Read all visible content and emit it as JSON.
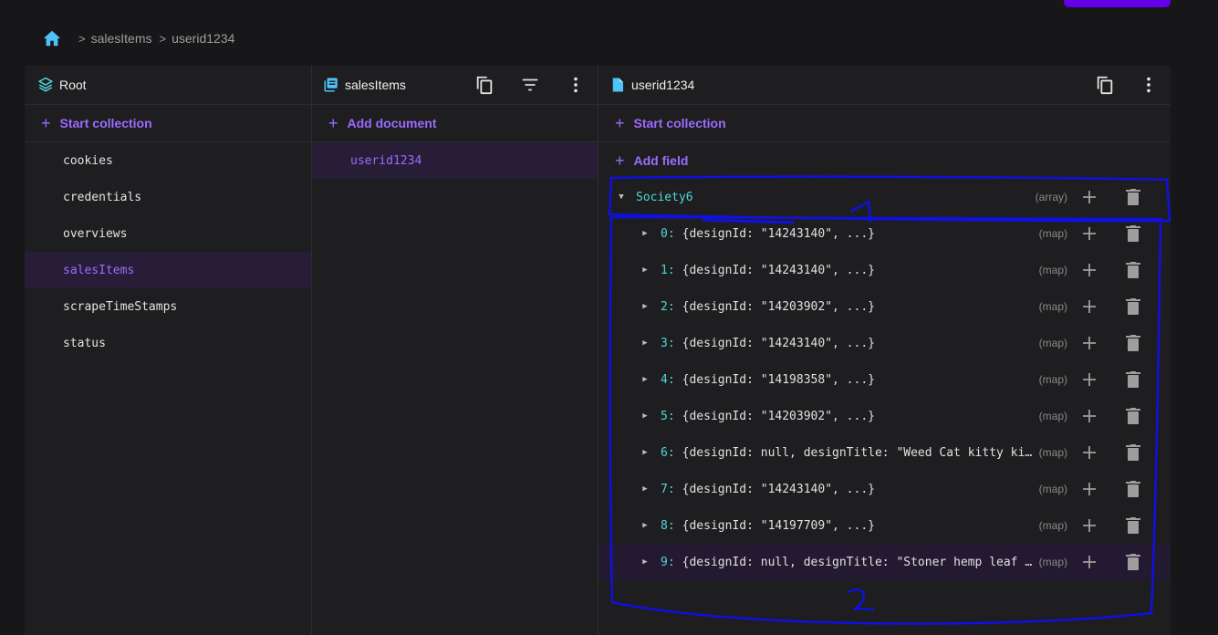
{
  "breadcrumb": {
    "home_icon": "home-icon",
    "items": [
      "salesItems",
      "userid1234"
    ]
  },
  "root_panel": {
    "title": "Root",
    "start_collection": "Start collection",
    "collections": [
      "cookies",
      "credentials",
      "overviews",
      "salesItems",
      "scrapeTimeStamps",
      "status"
    ],
    "selected": "salesItems"
  },
  "collection_panel": {
    "title": "salesItems",
    "add_document": "Add document",
    "documents": [
      "userid1234"
    ],
    "selected": "userid1234"
  },
  "document_panel": {
    "title": "userid1234",
    "start_collection": "Start collection",
    "add_field": "Add field",
    "field": {
      "key": "Society6",
      "type": "(array)"
    },
    "entries": [
      {
        "index": "0:",
        "value": "{designId: \"14243140\", ...}",
        "type": "(map)"
      },
      {
        "index": "1:",
        "value": "{designId: \"14243140\", ...}",
        "type": "(map)"
      },
      {
        "index": "2:",
        "value": "{designId: \"14203902\", ...}",
        "type": "(map)"
      },
      {
        "index": "3:",
        "value": "{designId: \"14243140\", ...}",
        "type": "(map)"
      },
      {
        "index": "4:",
        "value": "{designId: \"14198358\", ...}",
        "type": "(map)"
      },
      {
        "index": "5:",
        "value": "{designId: \"14203902\", ...}",
        "type": "(map)"
      },
      {
        "index": "6:",
        "value": "{designId: null, designTitle: \"Weed Cat kitty ki…",
        "type": "(map)"
      },
      {
        "index": "7:",
        "value": "{designId: \"14243140\", ...}",
        "type": "(map)"
      },
      {
        "index": "8:",
        "value": "{designId: \"14197709\", ...}",
        "type": "(map)"
      },
      {
        "index": "9:",
        "value": "{designId: null, designTitle: \"Stoner hemp leaf …",
        "type": "(map)"
      }
    ]
  },
  "annotations": {
    "label_1": "1",
    "label_2": "2",
    "color": "#1010e0"
  },
  "colors": {
    "accent": "#9c6bff",
    "key": "#4fd6d6",
    "selected_bg": "#281d37"
  }
}
